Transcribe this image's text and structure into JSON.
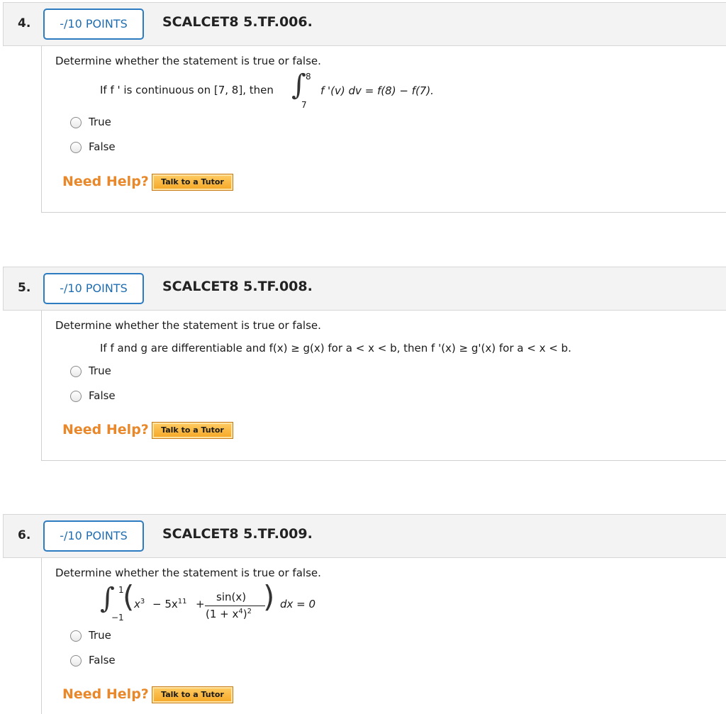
{
  "questions": [
    {
      "number": "4.",
      "points": "-/10 POINTS",
      "code": "SCALCET8 5.TF.006.",
      "prompt": "Determine whether the statement is true or false.",
      "statement_intro": "If f ' is continuous on [7, 8], then",
      "integral": {
        "upper": "8",
        "lower": "7",
        "integrand": "f '(v) dv = f(8) − f(7)."
      },
      "choices": [
        "True",
        "False"
      ],
      "need_help": "Need Help?",
      "tutor_button": "Talk to a Tutor"
    },
    {
      "number": "5.",
      "points": "-/10 POINTS",
      "code": "SCALCET8 5.TF.008.",
      "prompt": "Determine whether the statement is true or false.",
      "statement": "If f and g are differentiable and f(x) ≥ g(x) for a < x < b, then f '(x) ≥ g'(x) for a < x < b.",
      "choices": [
        "True",
        "False"
      ],
      "need_help": "Need Help?",
      "tutor_button": "Talk to a Tutor"
    },
    {
      "number": "6.",
      "points": "-/10 POINTS",
      "code": "SCALCET8 5.TF.009.",
      "prompt": "Determine whether the statement is true or false.",
      "integral": {
        "upper": "1",
        "lower": "−1",
        "term1": "x",
        "term1_exp": "3",
        "term2": "− 5x",
        "term2_exp": "11",
        "plus": "+",
        "numerator": "sin(x)",
        "denominator": "(1 + x",
        "denominator_inner_exp": "4",
        "denominator_close": ")",
        "denominator_exp": "2",
        "tail": "dx = 0"
      },
      "choices": [
        "True",
        "False"
      ],
      "need_help": "Need Help?",
      "tutor_button": "Talk to a Tutor"
    }
  ],
  "colors": {
    "points_border": "#2d7cc1",
    "points_text": "#1f6db0",
    "need_help": "#e8882a",
    "tutor_button": "#f5a623",
    "header_bg": "#f3f3f3"
  }
}
